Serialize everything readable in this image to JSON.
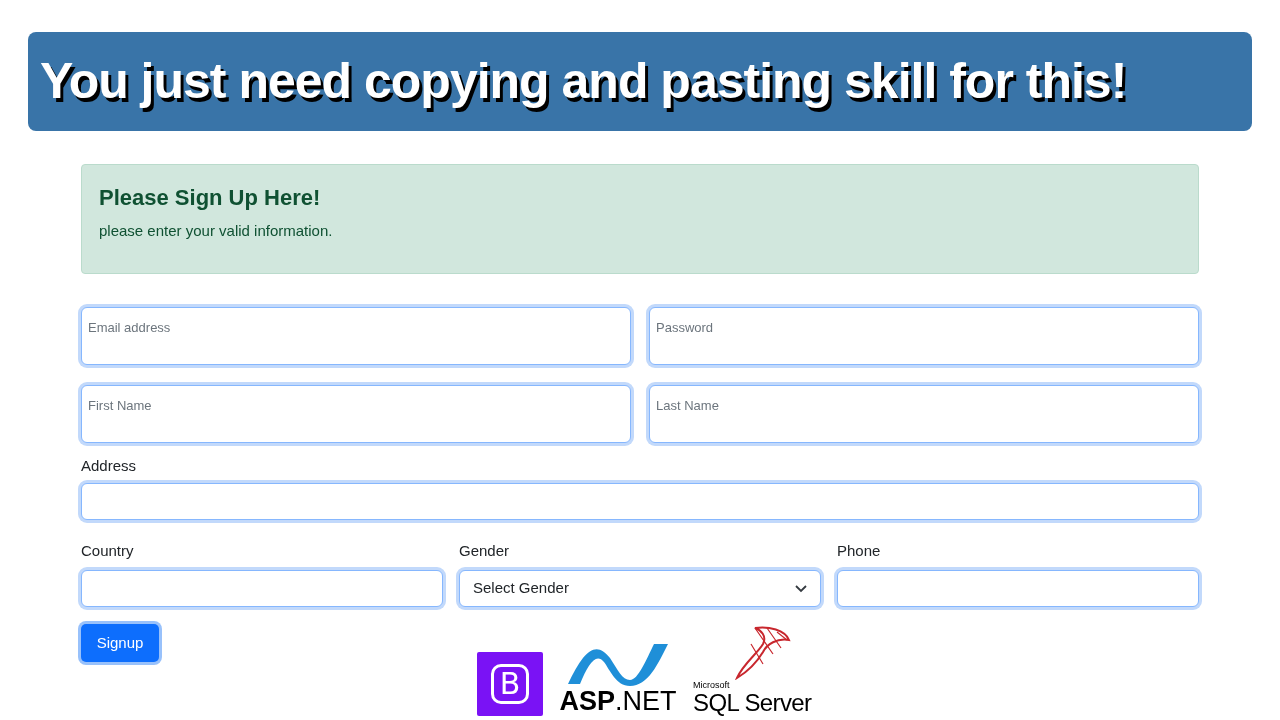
{
  "banner": {
    "title": "You just need copying and pasting skill for this!"
  },
  "alert": {
    "heading": "Please Sign Up Here!",
    "text": "please enter your valid information."
  },
  "floating_fields": [
    {
      "label": "Email address"
    },
    {
      "label": "Password"
    },
    {
      "label": "First Name"
    },
    {
      "label": "Last Name"
    }
  ],
  "address": {
    "label": "Address"
  },
  "fields_row": [
    {
      "label": "Country",
      "kind": "input"
    },
    {
      "label": "Gender",
      "kind": "select",
      "value": "Select Gender"
    },
    {
      "label": "Phone",
      "kind": "input"
    }
  ],
  "signup_button": "Signup",
  "logos": [
    {
      "kind": "bootstrap",
      "text": "B"
    },
    {
      "kind": "aspnet",
      "text": "**ASP**.NET"
    },
    {
      "kind": "sqlserver",
      "caption": "Microsoft",
      "text": "SQL Server"
    }
  ]
}
